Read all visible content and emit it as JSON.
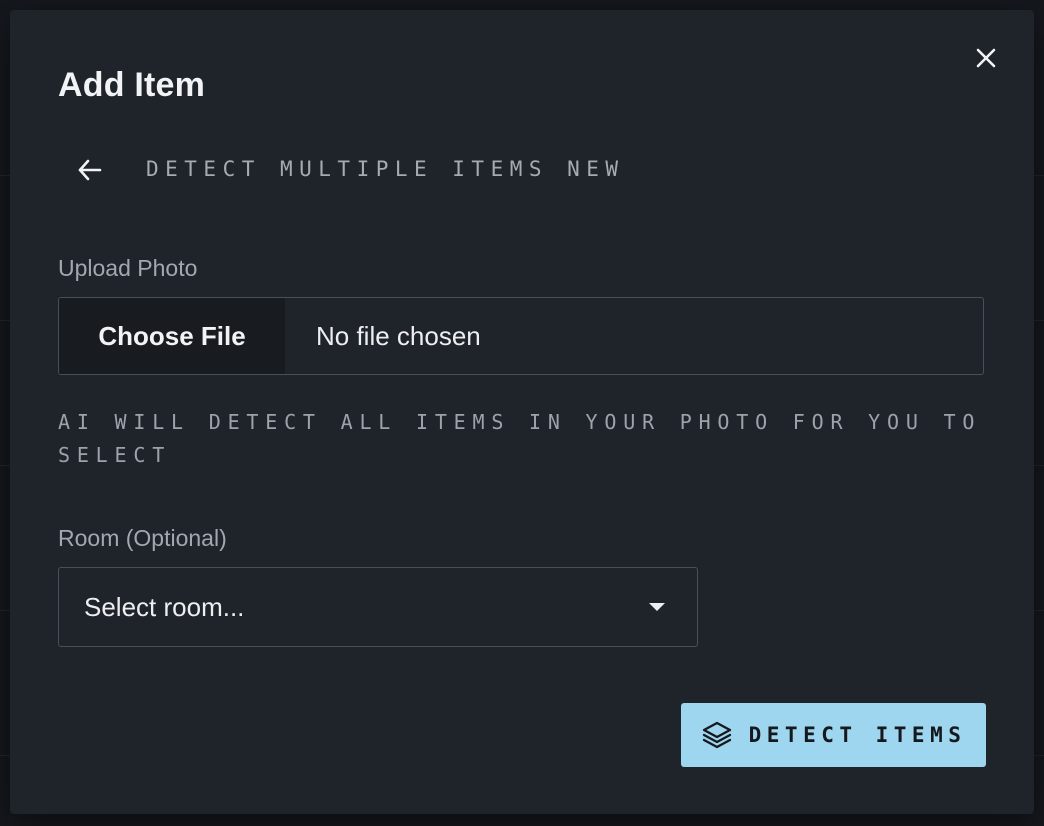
{
  "modal": {
    "title": "Add Item",
    "mode_label": "DETECT MULTIPLE ITEMS NEW"
  },
  "upload": {
    "label": "Upload Photo",
    "choose_button": "Choose File",
    "status": "No file chosen",
    "hint": "AI WILL DETECT ALL ITEMS IN YOUR PHOTO FOR YOU TO SELECT"
  },
  "room": {
    "label": "Room (Optional)",
    "selected": "Select room..."
  },
  "actions": {
    "detect_label": "DETECT ITEMS"
  },
  "icons": {
    "close": "close-icon",
    "back": "arrow-left-icon",
    "detect": "layers-icon",
    "dropdown": "caret-down-icon"
  },
  "colors": {
    "accent": "#9ed6ef",
    "modal_bg": "#1f232a"
  }
}
